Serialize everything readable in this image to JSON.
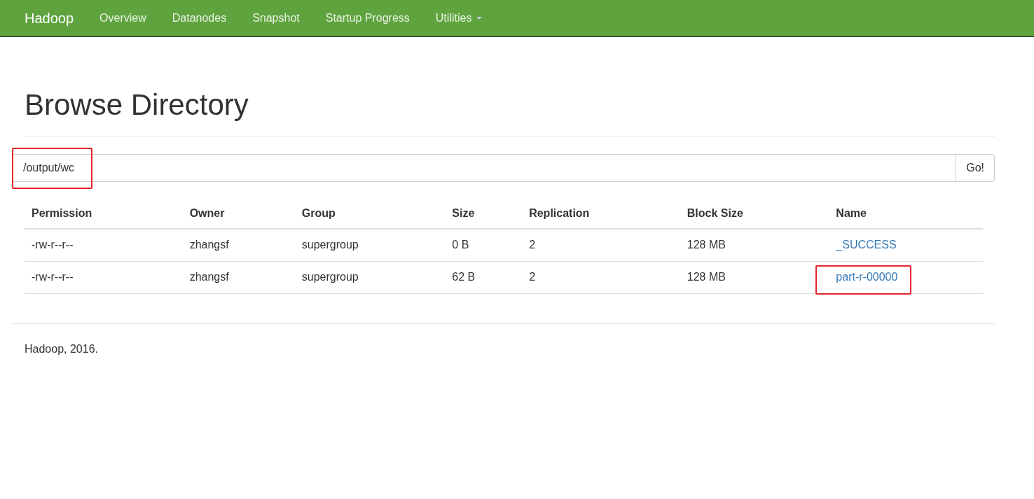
{
  "navbar": {
    "brand": "Hadoop",
    "items": [
      {
        "label": "Overview",
        "dropdown": false
      },
      {
        "label": "Datanodes",
        "dropdown": false
      },
      {
        "label": "Snapshot",
        "dropdown": false
      },
      {
        "label": "Startup Progress",
        "dropdown": false
      },
      {
        "label": "Utilities",
        "dropdown": true
      }
    ]
  },
  "page_title": "Browse Directory",
  "path_field": {
    "value": "/output/wc",
    "highlighted": true
  },
  "go_button": "Go!",
  "table": {
    "columns": [
      "Permission",
      "Owner",
      "Group",
      "Size",
      "Replication",
      "Block Size",
      "Name"
    ],
    "rows": [
      {
        "cells": [
          "-rw-r--r--",
          "zhangsf",
          "supergroup",
          "0 B",
          "2",
          "128 MB"
        ],
        "name": "_SUCCESS",
        "highlighted": false
      },
      {
        "cells": [
          "-rw-r--r--",
          "zhangsf",
          "supergroup",
          "62 B",
          "2",
          "128 MB"
        ],
        "name": "part-r-00000",
        "highlighted": true
      }
    ]
  },
  "footer": "Hadoop, 2016."
}
